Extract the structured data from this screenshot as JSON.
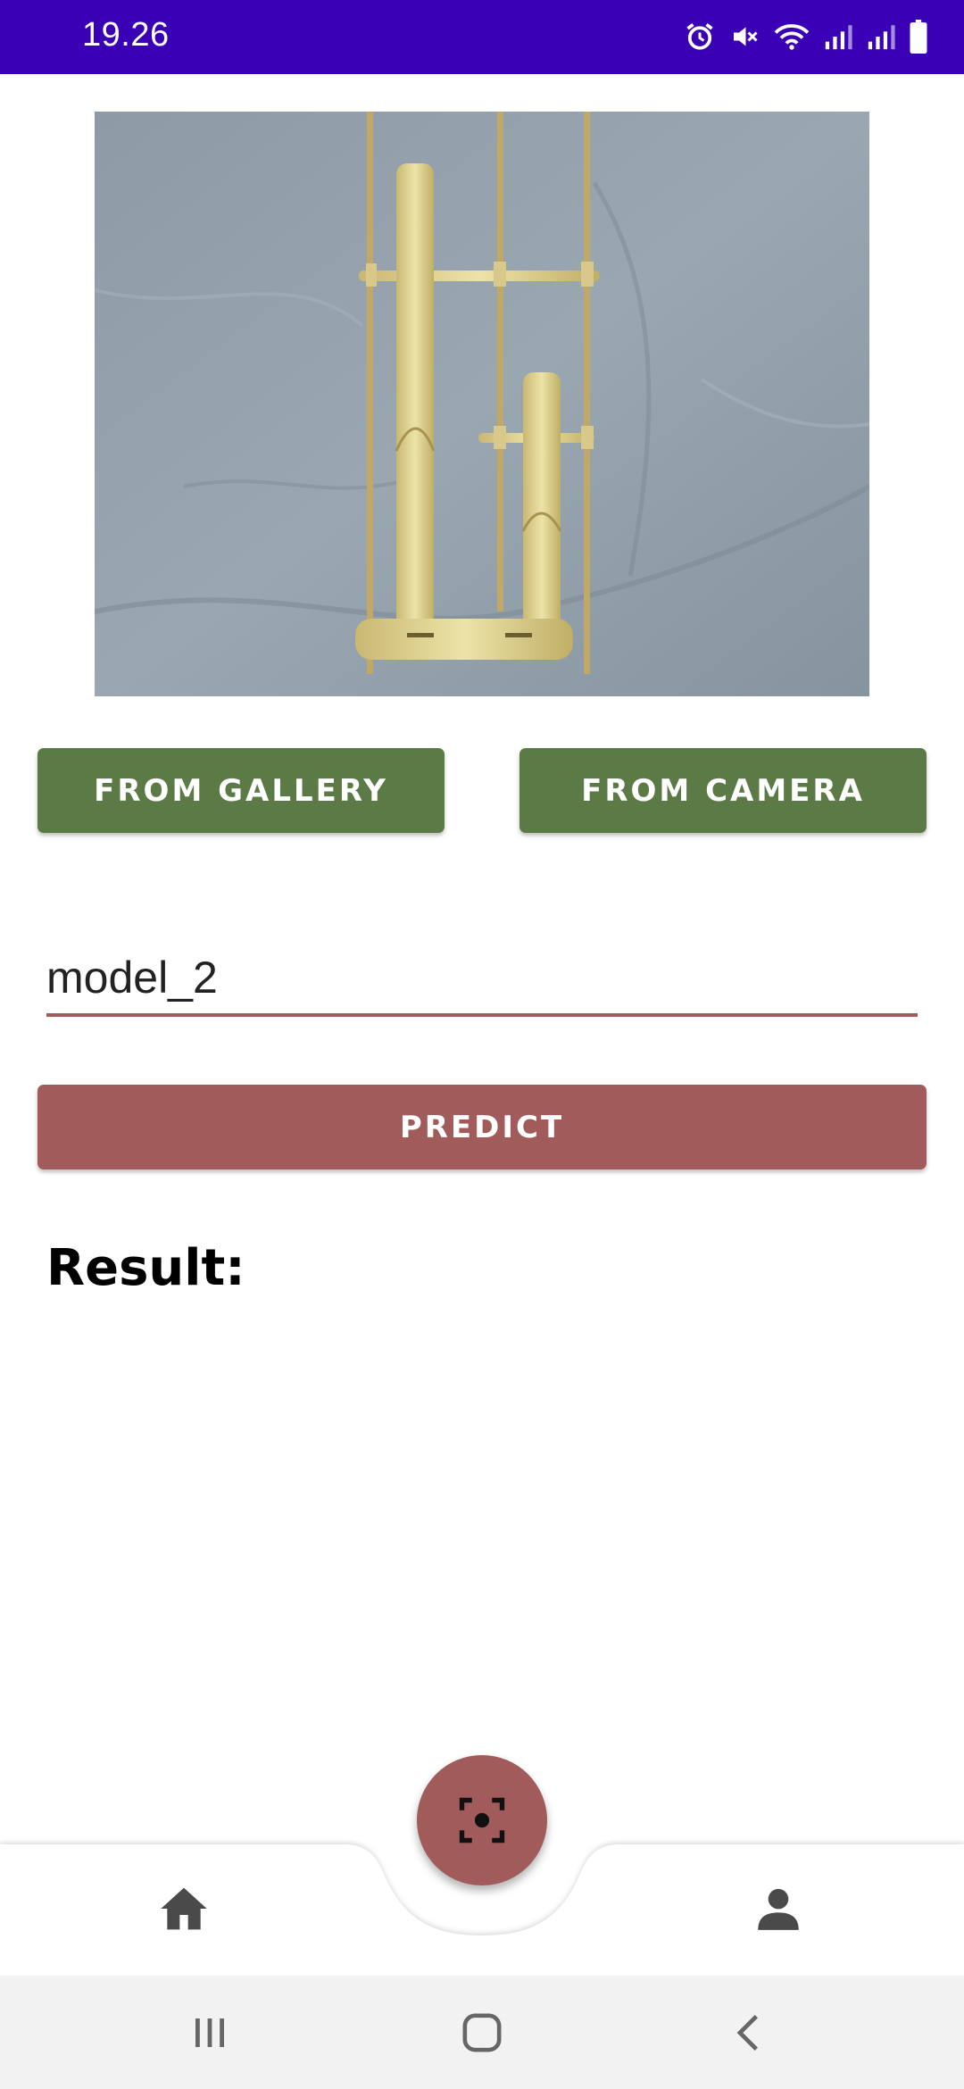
{
  "status_bar": {
    "time": "19.26",
    "icons": [
      "alarm-icon",
      "mute-icon",
      "wifi-icon",
      "signal-icon",
      "signal-icon",
      "battery-icon"
    ]
  },
  "preview": {
    "icon": "angklung-image"
  },
  "buttons": {
    "gallery_label": "FROM GALLERY",
    "camera_label": "FROM CAMERA",
    "predict_label": "PREDICT"
  },
  "model_field": {
    "value": "model_2"
  },
  "result": {
    "label": "Result:"
  },
  "bottom_nav": {
    "items": [
      "home-icon",
      "scan-icon",
      "person-icon"
    ]
  },
  "system_nav": {
    "items": [
      "recents-icon",
      "home-circle-icon",
      "back-icon"
    ]
  },
  "colors": {
    "status_bar": "#3a00b5",
    "green_button": "#5b7a46",
    "accent": "#a25b5b",
    "nav_icon": "#4a4a4a"
  }
}
